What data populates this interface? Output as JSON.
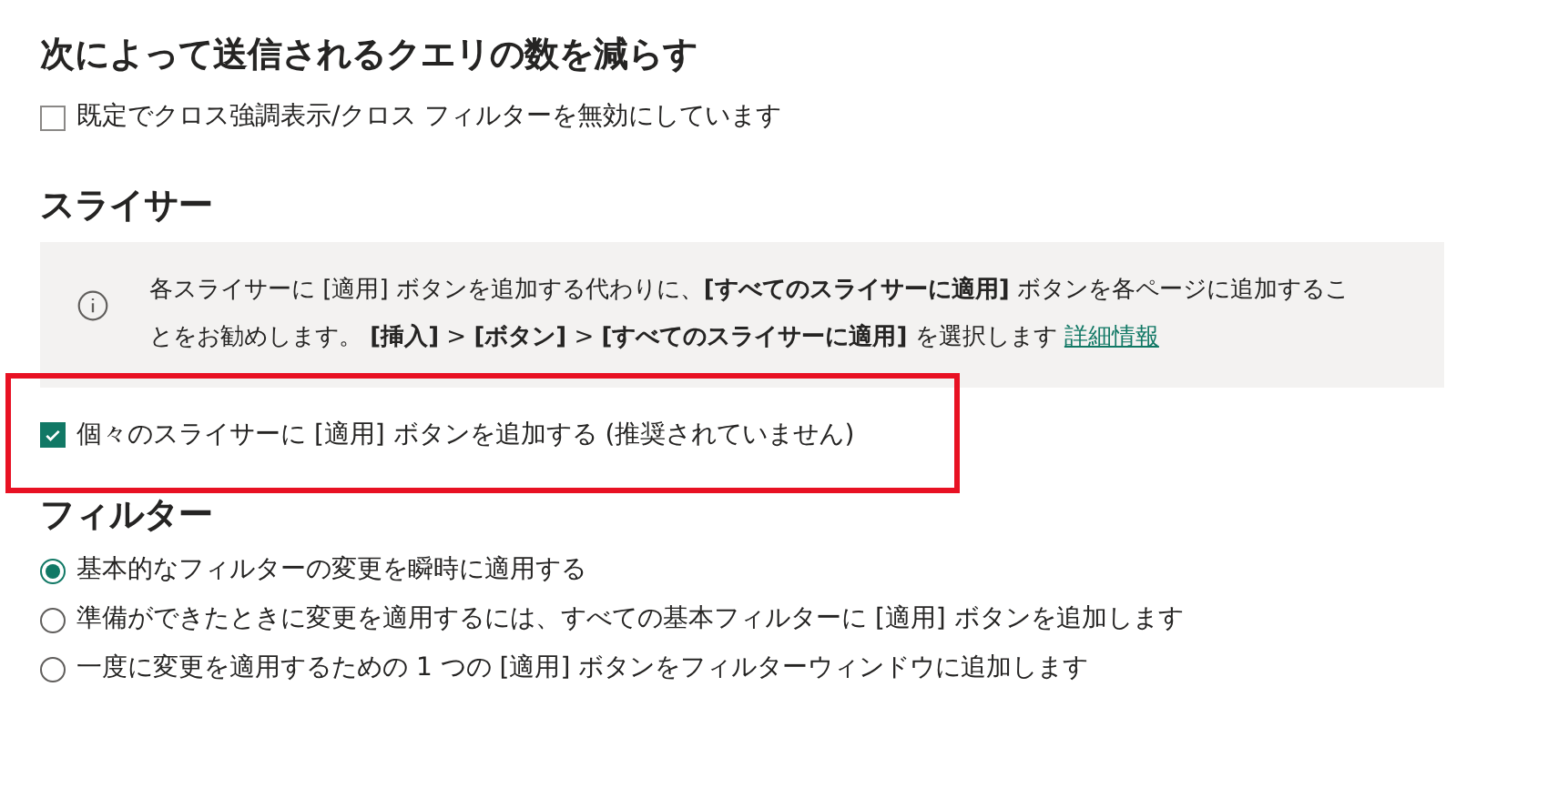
{
  "query_section": {
    "title": "次によって送信されるクエリの数を減らす",
    "checkbox": {
      "label": "既定でクロス強調表示/クロス フィルターを無効にしています",
      "checked": false
    }
  },
  "slicer_section": {
    "title": "スライサー",
    "info": {
      "text": "各スライサーに [適用] ボタンを追加する代わりに、**[すべてのスライサーに適用]** ボタンを各ページに追加することをお勧めします。 **[挿入]** > **[ボタン]** > **[すべてのスライサーに適用]** を選択します",
      "link": "詳細情報"
    },
    "checkbox": {
      "label": "個々のスライサーに [適用] ボタンを追加する (推奨されていません)",
      "checked": true,
      "highlighted": true
    }
  },
  "filter_section": {
    "title": "フィルター",
    "options": [
      {
        "label": "基本的なフィルターの変更を瞬時に適用する",
        "selected": true
      },
      {
        "label": "準備ができたときに変更を適用するには、すべての基本フィルターに [適用] ボタンを追加します",
        "selected": false
      },
      {
        "label": "一度に変更を適用するための 1 つの [適用] ボタンをフィルターウィンドウに追加します",
        "selected": false
      }
    ]
  }
}
